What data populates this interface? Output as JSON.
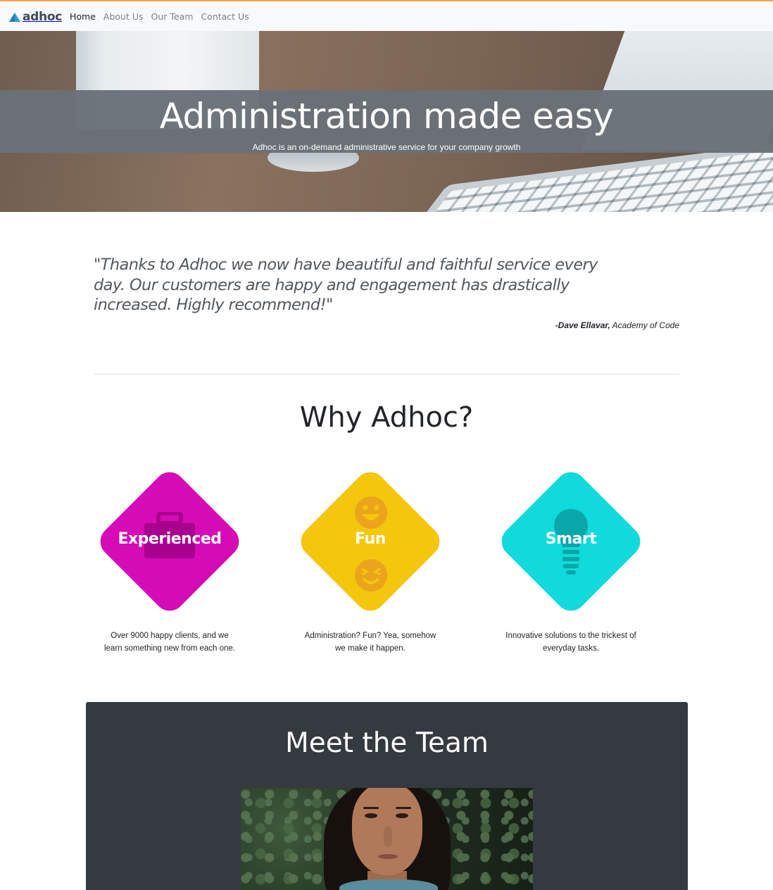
{
  "brand": {
    "name": "adhoc"
  },
  "nav": {
    "items": [
      "Home",
      "About Us",
      "Our Team",
      "Contact Us"
    ]
  },
  "hero": {
    "title": "Administration made easy",
    "subtitle": "Adhoc is an on-demand administrative service for your company growth"
  },
  "testimonial": {
    "quote": "\"Thanks to Adhoc we now have beautiful and faithful service every day. Our customers are happy and engagement has drastically increased. Highly recommend!\"",
    "author": "-Dave Ellavar,",
    "company": "Academy of Code"
  },
  "why": {
    "title": "Why Adhoc?",
    "features": [
      {
        "label": "Experienced",
        "color": "#d50bb5",
        "icon": "briefcase-icon",
        "description": "Over 9000 happy clients, and we learn something new from each one."
      },
      {
        "label": "Fun",
        "color": "#f4c60d",
        "icon": "smiley-icon",
        "description": "Administration? Fun? Yea, somehow we make it happen."
      },
      {
        "label": "Smart",
        "color": "#10dadb",
        "icon": "lightbulb-icon",
        "description": "Innovative solutions to the trickest of everyday tasks."
      }
    ]
  },
  "team": {
    "title": "Meet the Team"
  },
  "colors": {
    "navbar_bg": "#f8f9fa",
    "hero_band": "#6a7178",
    "team_bg": "#343a40",
    "top_accent": "#f0a64a"
  }
}
